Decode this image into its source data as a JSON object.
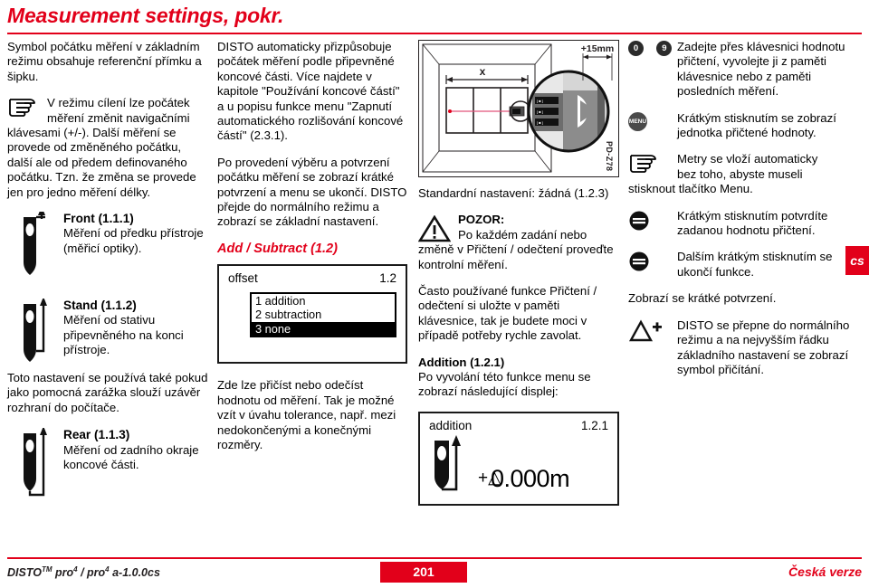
{
  "header": {
    "title": "Measurement settings, pokr.",
    "accent_color": "#e2001a"
  },
  "column1": {
    "intro": "Symbol počátku měření v základním režimu obsahuje referenční přímku a šipku.",
    "note1_icon": "hand-pointing-icon",
    "note1_line1": "V režimu cílení lze počátek",
    "note1_line2": "měření změnit navigačními",
    "note1_rest": "klávesami (+/-). Další měření se provede od změněného počátku, další ale od předem definovaného počátku. Tzn. že změna se provede jen pro jedno měření délky.",
    "ref_front_title": "Front (1.1.1)",
    "ref_front_text": "Měření od předku přístroje (měřicí optiky).",
    "ref_stand_title": "Stand (1.1.2)",
    "ref_stand_text": "Měření od stativu připevněného na konci přístroje.",
    "stand_note": "Toto nastavení se používá také pokud jako pomocná zarážka slouží uzávěr rozhraní do počítače.",
    "ref_rear_title": "Rear (1.1.3)",
    "ref_rear_text": "Měření od zadního okraje koncové části."
  },
  "column2": {
    "para1": "DISTO automaticky přizpůsobuje počátek měření podle připevněné koncové části. Více najdete v kapitole \"Používání koncové částí\" a u popisu funkce menu \"Zapnutí automatického rozlišování koncové částí\" (2.3.1).",
    "para2": "Po provedení výběru a potvrzení počátku měření se zobrazí krátké potvrzení a menu se ukončí. DISTO přejde do normálního režimu a zobrazí se základní nastavení.",
    "heading": "Add / Subtract (1.2)",
    "lcd": {
      "label": "offset",
      "code": "1.2",
      "options": [
        {
          "text": "1 addition",
          "selected": false
        },
        {
          "text": "2 subtraction",
          "selected": false
        },
        {
          "text": "3 none",
          "selected": true
        }
      ]
    },
    "para3": "Zde lze přičíst nebo odečíst hodnotu od měření. Tak je možné vzít v úvahu tolerance, např. mezi nedokončenými a konečnými rozměry."
  },
  "column3": {
    "illustration": {
      "dimension_label": "x",
      "offset_label": "+15mm",
      "pd_code": "PD-Z78"
    },
    "standard_setting": "Standardní nastavení: žádná (1.2.3)",
    "warning_icon": "warning-triangle-icon",
    "warning_title": "POZOR:",
    "warning_line1": "Po každém zadání nebo",
    "warning_rest": "změně v Přičtení / odečtení proveďte kontrolní měření.",
    "para_tip": "Často používané funkce Přičtení / odečtení si uložte v paměti klávesnice, tak je budete moci v případě potřeby rychle zavolat.",
    "addition_heading": "Addition (1.2.1)",
    "addition_text": "Po vyvolání této funkce menu se zobrazí následující displej:",
    "addition_lcd": {
      "label": "addition",
      "code": "1.2.1",
      "symbol": "+△",
      "value": "0.000m"
    }
  },
  "column4": {
    "rows": [
      {
        "icons": [
          "0",
          "9"
        ],
        "icon_type": "numeric-keys",
        "text": "Zadejte přes klávesnici hodnotu přičtení, vyvolejte ji z paměti klávesnice nebo z paměti posledních měření."
      },
      {
        "icons": [
          "MENU"
        ],
        "icon_type": "menu-key",
        "text": "Krátkým stisknutím se zobrazí jednotka přičtené hodnoty."
      },
      {
        "icons": [],
        "icon_type": "hand-pointing-icon",
        "text_line1": "Metry se vloží automaticky",
        "text_line2": "bez toho, abyste museli",
        "text_rest": "stisknout tlačítko Menu."
      },
      {
        "icons": [],
        "icon_type": "equals-button-icon",
        "text": "Krátkým stisknutím potvrdíte zadanou hodnotu přičtení."
      },
      {
        "icons": [],
        "icon_type": "equals-button-icon",
        "text": "Dalším krátkým stisknutím se ukončí funkce."
      }
    ],
    "confirm_text": "Zobrazí se krátké potvrzení.",
    "last_row": {
      "icon_type": "delta-plus-icon",
      "text": "DISTO se přepne do normálního režimu a na nejvyšším řádku základního nastavení se zobrazí symbol přičítání."
    },
    "language_tab": "cs"
  },
  "footer": {
    "left_prefix": "DISTO",
    "left_tm": "TM",
    "left_model": " pro",
    "left_sup1": "4",
    "left_mid": " / pro",
    "left_sup2": "4",
    "left_suffix": " a-1.0.0cs",
    "page_number": "201",
    "right": "Česká verze"
  }
}
